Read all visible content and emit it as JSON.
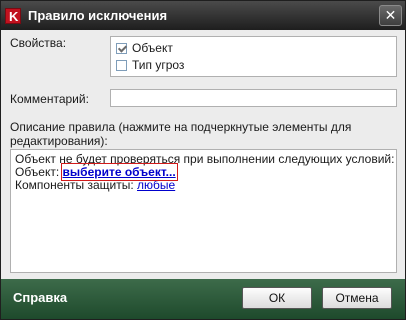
{
  "window": {
    "title": "Правило исключения",
    "app_icon_letter": "K",
    "close_symbol": "✕"
  },
  "properties": {
    "label": "Свойства:",
    "options": [
      {
        "label": "Объект",
        "checked": true
      },
      {
        "label": "Тип угроз",
        "checked": false
      }
    ]
  },
  "comment": {
    "label": "Комментарий:",
    "value": ""
  },
  "description": {
    "label_line1": "Описание правила (нажмите на подчеркнутые элементы для",
    "label_line2": "редактирования):",
    "line1": "Объект не будет проверяться при выполнении следующих условий:",
    "object_prefix": "Объект: ",
    "object_link": "выберите объект...",
    "components_prefix": "Компоненты защиты: ",
    "components_link": "любые"
  },
  "footer": {
    "help": "Справка",
    "ok": "ОК",
    "cancel": "Отмена"
  }
}
